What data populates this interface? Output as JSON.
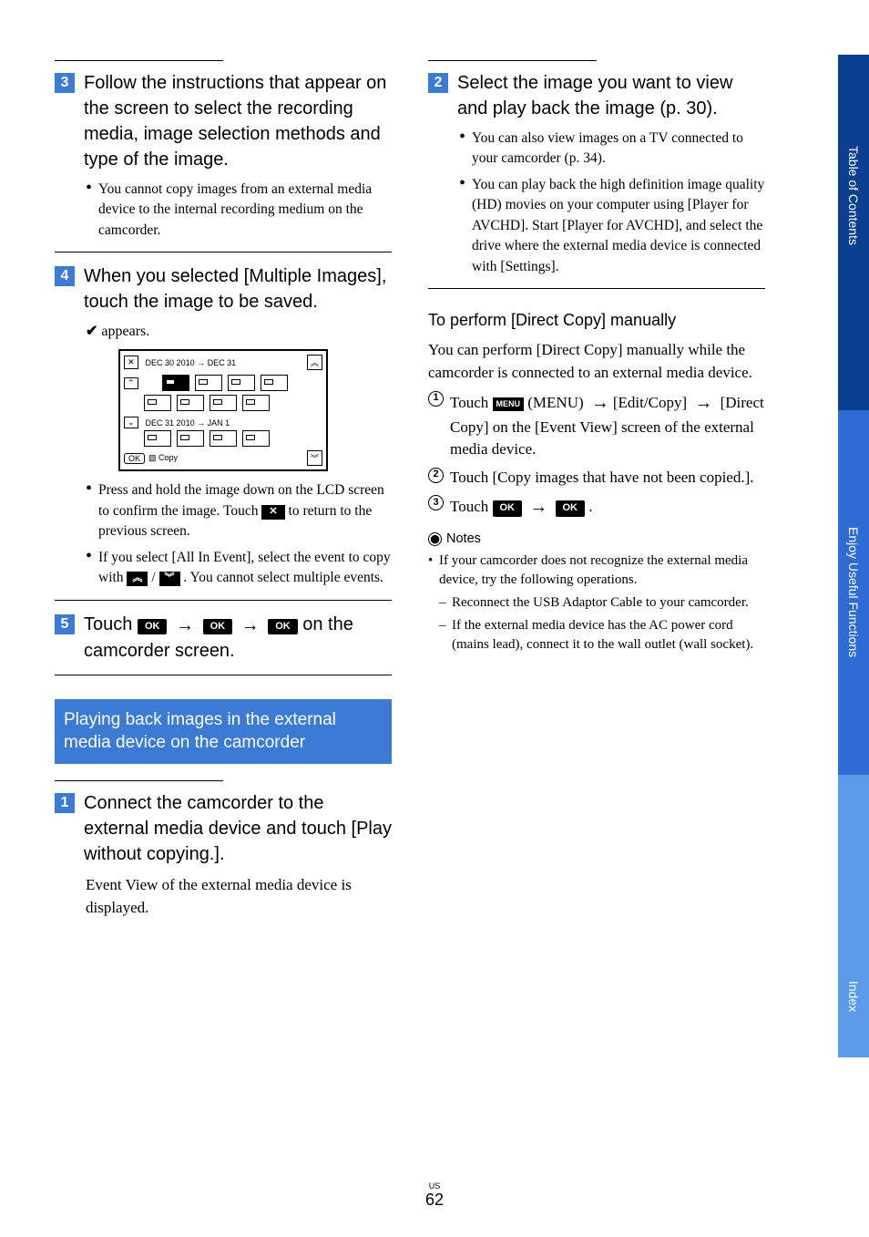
{
  "side_tabs": {
    "t1": "Table of Contents",
    "t2": "Enjoy Useful Functions",
    "t3": "Index"
  },
  "left": {
    "step3": {
      "num": "3",
      "head": "Follow the instructions that appear on the screen to select the recording media, image selection methods and type of the image.",
      "bullet1": "You cannot copy images from an external media device to the internal recording medium on the camcorder."
    },
    "step4": {
      "num": "4",
      "head": "When you selected [Multiple Images], touch the image to be saved.",
      "appears": "appears.",
      "screen": {
        "date1": "DEC 30 2010 → DEC 31",
        "date2": "DEC 31 2010 → JAN 1",
        "ok": "OK",
        "copy": "Copy"
      },
      "bullet1_a": "Press and hold the image down on the LCD screen to confirm the image. Touch ",
      "bullet1_b": " to return to the previous screen.",
      "bullet2_a": "If you select [All In Event], select the event to copy with ",
      "bullet2_b": " / ",
      "bullet2_c": " . You cannot select multiple events."
    },
    "step5": {
      "num": "5",
      "head_a": "Touch ",
      "head_b": " on the camcorder screen."
    },
    "section_heading": "Playing back images in the external media device on the camcorder",
    "step1": {
      "num": "1",
      "head": "Connect the camcorder to the external media device and touch [Play without copying.].",
      "body": "Event View of the external media device is displayed."
    }
  },
  "right": {
    "step2": {
      "num": "2",
      "head": "Select the image you want to view and play back the image (p. 30).",
      "bullet1": "You can also view images on a TV connected to your camcorder (p. 34).",
      "bullet2": "You can play back the high definition image quality (HD) movies on your computer using [Player for AVCHD]. Start [Player for AVCHD], and select the drive where the external media device is connected with [Settings]."
    },
    "manual": {
      "subhead": "To perform [Direct Copy] manually",
      "body": "You can perform [Direct Copy] manually while the camcorder is connected to an external media device.",
      "n1_a": "Touch ",
      "n1_menu": "MENU",
      "n1_b": " (MENU) ",
      "n1_c": "[Edit/Copy] ",
      "n1_d": " [Direct Copy] on the [Event View] screen of the external media device.",
      "n2": "Touch [Copy images that have not been copied.].",
      "n3_a": "Touch ",
      "n3_b": "."
    },
    "notes": {
      "label": "Notes",
      "n1": "If your camcorder does not recognize the external media device, try the following operations.",
      "n1a": "Reconnect the USB Adaptor Cable to your camcorder.",
      "n1b": "If the external media device has the AC power cord (mains lead), connect it to the wall outlet (wall socket)."
    }
  },
  "page_region": "US",
  "page_number": "62",
  "icons": {
    "ok": "OK",
    "x": "✕",
    "up": "︽",
    "down": "︾",
    "arrow": "→"
  }
}
